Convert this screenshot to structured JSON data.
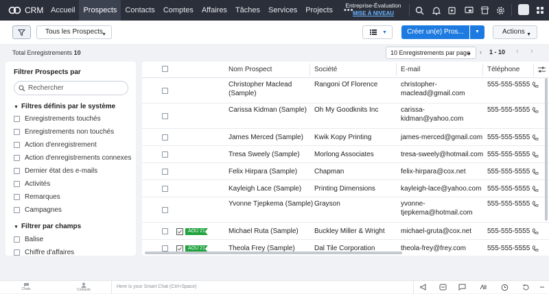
{
  "app": {
    "logo_text": "CRM"
  },
  "nav": {
    "items": [
      "Accueil",
      "Prospects",
      "Contacts",
      "Comptes",
      "Affaires",
      "Tâches",
      "Services",
      "Projects"
    ],
    "active_index": 1,
    "more": "•••"
  },
  "trial": {
    "label": "Entreprise-Évaluation",
    "link": "MISE À NIVEAU"
  },
  "toolbar": {
    "view_label": "Tous les Prospects",
    "create_label": "Créer un(e) Pros...",
    "actions_label": "Actions"
  },
  "records": {
    "total_label": "Total Enregistrements",
    "total_count": "10",
    "per_page": "10 Enregistrements par page",
    "range": "1 - 10"
  },
  "filter": {
    "title": "Filtrer Prospects par",
    "search_placeholder": "Rechercher",
    "system_section": "Filtres définis par le système",
    "system_items": [
      "Enregistrements touchés",
      "Enregistrements non touchés",
      "Action d'enregistrement",
      "Action d'enregistrements connexes",
      "Dernier état des e-mails",
      "Activités",
      "Remarques",
      "Campagnes"
    ],
    "fields_section": "Filtrer par champs",
    "field_items": [
      "Balise",
      "Chiffre d'affaires"
    ]
  },
  "table": {
    "columns": [
      "Nom Prospect",
      "Société",
      "E-mail",
      "Téléphone"
    ],
    "rows": [
      {
        "name": [
          "Christopher Maclead",
          "(Sample)"
        ],
        "company": "Rangoni Of Florence",
        "email": [
          "christopher-",
          "maclead@gmail.com"
        ],
        "phone": "555-555-5555",
        "tag": ""
      },
      {
        "name": [
          "Carissa Kidman (Sample)"
        ],
        "company": "Oh My Goodknits Inc",
        "email": [
          "carissa-",
          "kidman@yahoo.com"
        ],
        "phone": "555-555-5555",
        "tag": ""
      },
      {
        "name": [
          "James Merced (Sample)"
        ],
        "company": "Kwik Kopy Printing",
        "email": [
          "james-merced@gmail.com"
        ],
        "phone": "555-555-5555",
        "tag": ""
      },
      {
        "name": [
          "Tresa Sweely (Sample)"
        ],
        "company": "Morlong Associates",
        "email": [
          "tresa-sweely@hotmail.com"
        ],
        "phone": "555-555-5555",
        "tag": ""
      },
      {
        "name": [
          "Felix Hirpara (Sample)"
        ],
        "company": "Chapman",
        "email": [
          "felix-hirpara@cox.net"
        ],
        "phone": "555-555-5555",
        "tag": ""
      },
      {
        "name": [
          "Kayleigh Lace (Sample)"
        ],
        "company": "Printing Dimensions",
        "email": [
          "kayleigh-lace@yahoo.com"
        ],
        "phone": "555-555-5555",
        "tag": ""
      },
      {
        "name": [
          "Yvonne Tjepkema (Sample)"
        ],
        "company": "Grayson",
        "email": [
          "yvonne-",
          "tjepkema@hotmail.com"
        ],
        "phone": "555-555-5555",
        "tag": ""
      },
      {
        "name": [
          "Michael Ruta (Sample)"
        ],
        "company": "Buckley Miller & Wright",
        "email": [
          "michael-gruta@cox.net"
        ],
        "phone": "555-555-5555",
        "tag": "AOÛ 21"
      },
      {
        "name": [
          "Theola Frey (Sample)"
        ],
        "company": "Dal Tile Corporation",
        "email": [
          "theola-frey@frey.com"
        ],
        "phone": "555-555-5555",
        "tag": "AOÛ 21"
      }
    ]
  },
  "bottombar": {
    "chats_label": "Chats",
    "contacts_label": "Contacts",
    "smart_chat_placeholder": "Here is your Smart Chat (Ctrl+Space)"
  },
  "colors": {
    "topbar": "#2b2f3a",
    "accent": "#1d7ae0",
    "tag_green": "#1fa33d",
    "link": "#6ab4ff"
  },
  "icons": [
    "search-icon",
    "bell-icon",
    "add-note-icon",
    "screen-icon",
    "store-icon",
    "gear-icon",
    "filter-icon",
    "list-view-icon",
    "phone-icon",
    "task-icon",
    "column-settings-icon",
    "announce-icon",
    "chat-icon",
    "ai-icon",
    "clock-icon",
    "history-icon"
  ]
}
